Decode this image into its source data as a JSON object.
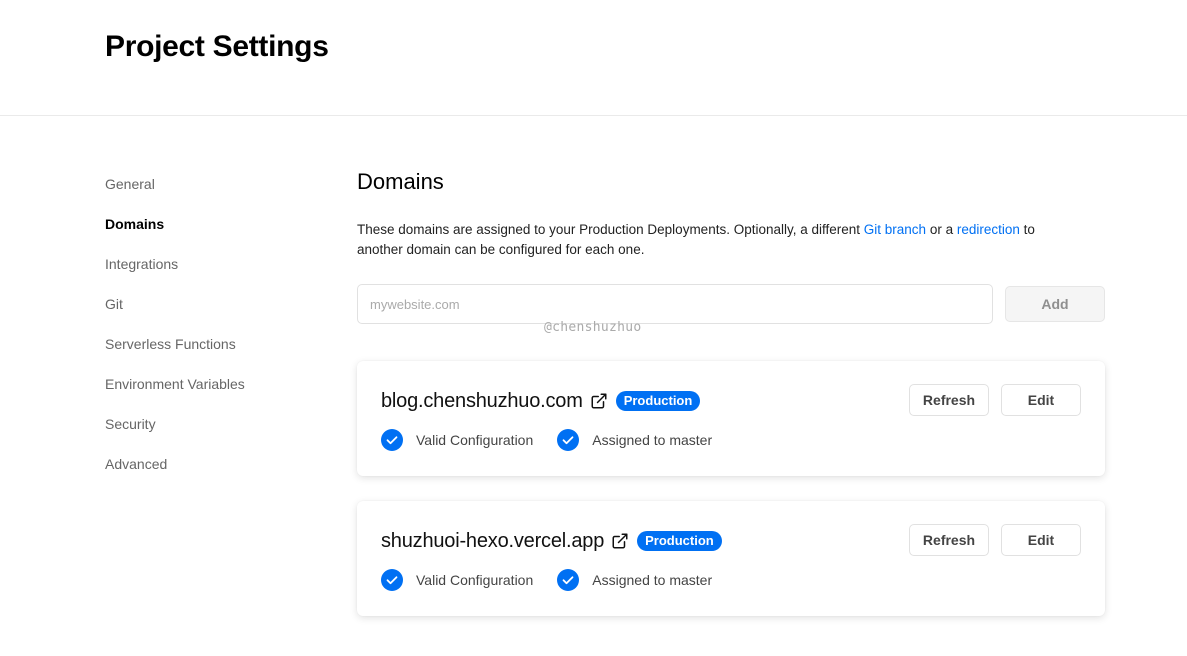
{
  "header": {
    "title": "Project Settings"
  },
  "sidebar": {
    "items": [
      {
        "label": "General"
      },
      {
        "label": "Domains"
      },
      {
        "label": "Integrations"
      },
      {
        "label": "Git"
      },
      {
        "label": "Serverless Functions"
      },
      {
        "label": "Environment Variables"
      },
      {
        "label": "Security"
      },
      {
        "label": "Advanced"
      }
    ],
    "active": "Domains"
  },
  "main": {
    "title": "Domains",
    "description": {
      "part1": "These domains are assigned to your Production Deployments. Optionally, a different ",
      "link1": "Git branch",
      "part2": " or a ",
      "link2": "redirection",
      "part3": " to another domain can be configured for each one."
    },
    "input": {
      "placeholder": "mywebsite.com",
      "value": ""
    },
    "add_label": "Add"
  },
  "watermark": "@chenshuzhuo",
  "domains": [
    {
      "name": "blog.chenshuzhuo.com",
      "badge": "Production",
      "status1": "Valid Configuration",
      "status2": "Assigned to master",
      "refresh_label": "Refresh",
      "edit_label": "Edit"
    },
    {
      "name": "shuzhuoi-hexo.vercel.app",
      "badge": "Production",
      "status1": "Valid Configuration",
      "status2": "Assigned to master",
      "refresh_label": "Refresh",
      "edit_label": "Edit"
    }
  ],
  "colors": {
    "accent": "#0070f3",
    "border": "#eaeaea",
    "muted_text": "#666666"
  },
  "icons": {
    "external_link": "external-link-icon",
    "check": "check-circle-icon"
  }
}
